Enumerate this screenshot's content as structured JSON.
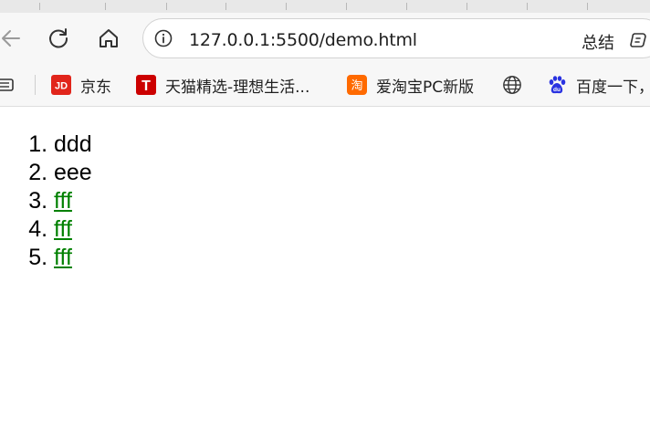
{
  "toolbar": {
    "url": "127.0.0.1:5500/demo.html",
    "summary_label": "总结"
  },
  "icons": {
    "back": "back-arrow-icon",
    "reload": "reload-icon",
    "home": "home-icon",
    "info": "info-icon",
    "copilot": "copilot-icon",
    "reading_list": "reading-list-icon",
    "globe": "globe-icon",
    "baidu": "baidu-paw-icon"
  },
  "bookmarks": [
    {
      "label": "京东",
      "icon_text": "JD",
      "color": "#e1251b"
    },
    {
      "label": "天猫精选-理想生活...",
      "icon_text": "T",
      "color": "#cc0000"
    },
    {
      "label": "爱淘宝PC新版",
      "icon_text": "淘",
      "color": "#ff6a00"
    },
    {
      "label": "",
      "icon_text": "",
      "color": "#333333"
    },
    {
      "label": "百度一下，",
      "icon_text": "du",
      "color": "#2932e1"
    }
  ],
  "list": {
    "items": [
      {
        "text": "ddd"
      },
      {
        "text": "eee"
      },
      {
        "text": "fff"
      },
      {
        "text": "fff"
      },
      {
        "text": "fff"
      }
    ],
    "link_color": "#008000"
  }
}
